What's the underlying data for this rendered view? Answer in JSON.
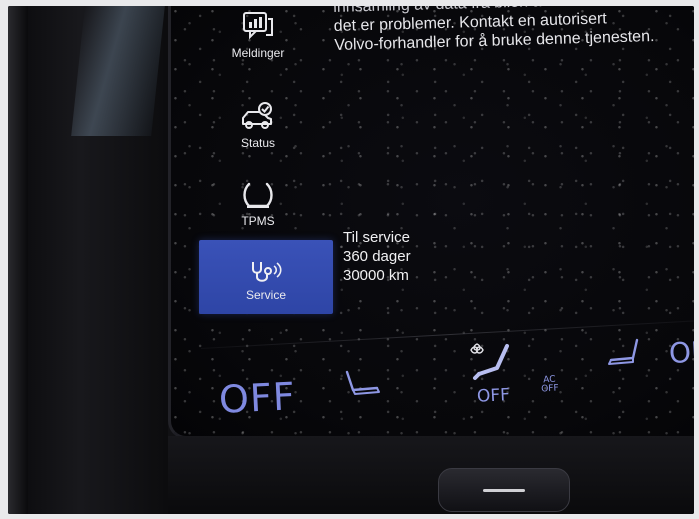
{
  "message": {
    "lines": [
      "innsamling av data fra bilen av en Volvo-tekniker når",
      "det er problemer. Kontakt en autorisert",
      "Volvo-forhandler for å bruke denne tjenesten."
    ]
  },
  "nav": {
    "items": [
      {
        "label": "Meldinger",
        "icon": "messages-icon"
      },
      {
        "label": "Status",
        "icon": "car-status-icon"
      },
      {
        "label": "TPMS",
        "icon": "tire-pressure-icon"
      },
      {
        "label": "Service",
        "icon": "stethoscope-icon",
        "selected": true
      }
    ]
  },
  "service_info": {
    "title": "Til service",
    "days": "360 dager",
    "distance": "30000 km"
  },
  "climate": {
    "left_off": "OFF",
    "seat_heat_off": "OFF",
    "ac_top": "AC",
    "ac_bottom": "OFF",
    "right_off": "OF"
  },
  "colors": {
    "selected_bg": "#3a52b8",
    "climate_text": "#8e97e4",
    "screen_text": "#e6e6ea"
  }
}
